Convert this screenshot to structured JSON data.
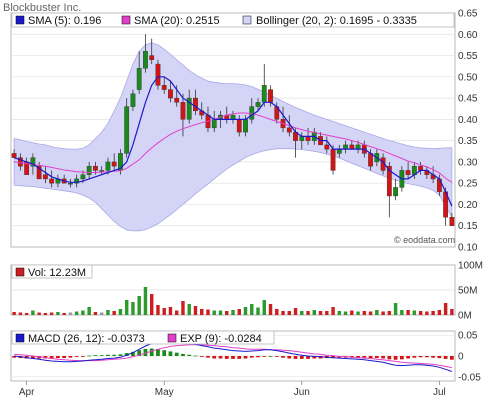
{
  "title": "Blockbuster Inc.",
  "watermark": "© eoddata.com",
  "colors": {
    "frame": "#b8b8b8",
    "grid": "#e2e2e2",
    "band_fill": "#d4d4f6",
    "band_edge": "#a8a8e8",
    "sma5": "#1a1acc",
    "sma20": "#e040c8",
    "up": "#1a8a1a",
    "down": "#d41414",
    "vol_up": "#2c9a2c",
    "vol_down": "#cc2020",
    "vol_neutral": "#999999",
    "macd": "#1a1acc",
    "exp": "#e040c8",
    "hist_pos": "#1a8a1a",
    "hist_neg": "#d41414"
  },
  "chart_data": [
    {
      "type": "candlestick",
      "title": "Blockbuster Inc.",
      "ylim": [
        0.1,
        0.65
      ],
      "ytick_labels": [
        "0.65",
        "0.60",
        "0.55",
        "0.50",
        "0.45",
        "0.40",
        "0.35",
        "0.30",
        "0.25",
        "0.20",
        "0.15",
        "0.10"
      ],
      "ytick_values": [
        0.65,
        0.6,
        0.55,
        0.5,
        0.45,
        0.4,
        0.35,
        0.3,
        0.25,
        0.2,
        0.15,
        0.1
      ],
      "x_tick_labels": [
        "Apr",
        "May",
        "Jun",
        "Jul"
      ],
      "legend": [
        {
          "key": "sma5",
          "label": "SMA (5): 0.196"
        },
        {
          "key": "sma20",
          "label": "SMA (20): 0.2515"
        },
        {
          "key": "bollinger",
          "label": "Bollinger (20, 2): 0.1695 - 0.3335"
        }
      ],
      "candles": [
        {
          "o": 0.32,
          "h": 0.33,
          "l": 0.31,
          "c": 0.31
        },
        {
          "o": 0.31,
          "h": 0.32,
          "l": 0.28,
          "c": 0.29
        },
        {
          "o": 0.3,
          "h": 0.31,
          "l": 0.27,
          "c": 0.27
        },
        {
          "o": 0.29,
          "h": 0.32,
          "l": 0.27,
          "c": 0.31
        },
        {
          "o": 0.29,
          "h": 0.3,
          "l": 0.26,
          "c": 0.26
        },
        {
          "o": 0.27,
          "h": 0.29,
          "l": 0.25,
          "c": 0.26
        },
        {
          "o": 0.26,
          "h": 0.28,
          "l": 0.24,
          "c": 0.25
        },
        {
          "o": 0.25,
          "h": 0.27,
          "l": 0.24,
          "c": 0.26
        },
        {
          "o": 0.26,
          "h": 0.27,
          "l": 0.25,
          "c": 0.25
        },
        {
          "o": 0.25,
          "h": 0.26,
          "l": 0.24,
          "c": 0.25
        },
        {
          "o": 0.25,
          "h": 0.27,
          "l": 0.24,
          "c": 0.26
        },
        {
          "o": 0.26,
          "h": 0.28,
          "l": 0.25,
          "c": 0.27
        },
        {
          "o": 0.27,
          "h": 0.3,
          "l": 0.26,
          "c": 0.29
        },
        {
          "o": 0.29,
          "h": 0.3,
          "l": 0.27,
          "c": 0.28
        },
        {
          "o": 0.28,
          "h": 0.29,
          "l": 0.27,
          "c": 0.28
        },
        {
          "o": 0.28,
          "h": 0.31,
          "l": 0.27,
          "c": 0.3
        },
        {
          "o": 0.3,
          "h": 0.32,
          "l": 0.28,
          "c": 0.29
        },
        {
          "o": 0.28,
          "h": 0.33,
          "l": 0.27,
          "c": 0.32
        },
        {
          "o": 0.32,
          "h": 0.45,
          "l": 0.31,
          "c": 0.43
        },
        {
          "o": 0.43,
          "h": 0.47,
          "l": 0.42,
          "c": 0.46
        },
        {
          "o": 0.47,
          "h": 0.56,
          "l": 0.46,
          "c": 0.52
        },
        {
          "o": 0.52,
          "h": 0.6,
          "l": 0.51,
          "c": 0.56
        },
        {
          "o": 0.55,
          "h": 0.59,
          "l": 0.53,
          "c": 0.54
        },
        {
          "o": 0.53,
          "h": 0.54,
          "l": 0.47,
          "c": 0.48
        },
        {
          "o": 0.48,
          "h": 0.5,
          "l": 0.46,
          "c": 0.47
        },
        {
          "o": 0.47,
          "h": 0.49,
          "l": 0.44,
          "c": 0.45
        },
        {
          "o": 0.45,
          "h": 0.48,
          "l": 0.43,
          "c": 0.44
        },
        {
          "o": 0.44,
          "h": 0.46,
          "l": 0.36,
          "c": 0.4
        },
        {
          "o": 0.4,
          "h": 0.47,
          "l": 0.39,
          "c": 0.45
        },
        {
          "o": 0.45,
          "h": 0.47,
          "l": 0.41,
          "c": 0.42
        },
        {
          "o": 0.42,
          "h": 0.44,
          "l": 0.4,
          "c": 0.41
        },
        {
          "o": 0.41,
          "h": 0.43,
          "l": 0.37,
          "c": 0.38
        },
        {
          "o": 0.38,
          "h": 0.42,
          "l": 0.37,
          "c": 0.4
        },
        {
          "o": 0.4,
          "h": 0.42,
          "l": 0.38,
          "c": 0.41
        },
        {
          "o": 0.41,
          "h": 0.43,
          "l": 0.39,
          "c": 0.4
        },
        {
          "o": 0.4,
          "h": 0.42,
          "l": 0.39,
          "c": 0.41
        },
        {
          "o": 0.4,
          "h": 0.41,
          "l": 0.36,
          "c": 0.37
        },
        {
          "o": 0.37,
          "h": 0.41,
          "l": 0.36,
          "c": 0.4
        },
        {
          "o": 0.4,
          "h": 0.45,
          "l": 0.39,
          "c": 0.43
        },
        {
          "o": 0.43,
          "h": 0.45,
          "l": 0.42,
          "c": 0.44
        },
        {
          "o": 0.44,
          "h": 0.53,
          "l": 0.43,
          "c": 0.48
        },
        {
          "o": 0.47,
          "h": 0.48,
          "l": 0.43,
          "c": 0.44
        },
        {
          "o": 0.43,
          "h": 0.44,
          "l": 0.39,
          "c": 0.4
        },
        {
          "o": 0.4,
          "h": 0.43,
          "l": 0.37,
          "c": 0.38
        },
        {
          "o": 0.38,
          "h": 0.41,
          "l": 0.36,
          "c": 0.37
        },
        {
          "o": 0.37,
          "h": 0.38,
          "l": 0.31,
          "c": 0.35
        },
        {
          "o": 0.35,
          "h": 0.37,
          "l": 0.33,
          "c": 0.36
        },
        {
          "o": 0.36,
          "h": 0.38,
          "l": 0.34,
          "c": 0.35
        },
        {
          "o": 0.35,
          "h": 0.38,
          "l": 0.34,
          "c": 0.37
        },
        {
          "o": 0.36,
          "h": 0.37,
          "l": 0.34,
          "c": 0.34
        },
        {
          "o": 0.34,
          "h": 0.36,
          "l": 0.32,
          "c": 0.33
        },
        {
          "o": 0.33,
          "h": 0.34,
          "l": 0.27,
          "c": 0.28
        },
        {
          "o": 0.32,
          "h": 0.34,
          "l": 0.31,
          "c": 0.33
        },
        {
          "o": 0.33,
          "h": 0.35,
          "l": 0.32,
          "c": 0.34
        },
        {
          "o": 0.34,
          "h": 0.35,
          "l": 0.33,
          "c": 0.33
        },
        {
          "o": 0.33,
          "h": 0.35,
          "l": 0.32,
          "c": 0.34
        },
        {
          "o": 0.34,
          "h": 0.35,
          "l": 0.31,
          "c": 0.32
        },
        {
          "o": 0.32,
          "h": 0.33,
          "l": 0.28,
          "c": 0.29
        },
        {
          "o": 0.3,
          "h": 0.33,
          "l": 0.29,
          "c": 0.32
        },
        {
          "o": 0.31,
          "h": 0.32,
          "l": 0.27,
          "c": 0.28
        },
        {
          "o": 0.29,
          "h": 0.3,
          "l": 0.17,
          "c": 0.22
        },
        {
          "o": 0.22,
          "h": 0.26,
          "l": 0.21,
          "c": 0.24
        },
        {
          "o": 0.24,
          "h": 0.29,
          "l": 0.23,
          "c": 0.28
        },
        {
          "o": 0.28,
          "h": 0.3,
          "l": 0.26,
          "c": 0.27
        },
        {
          "o": 0.27,
          "h": 0.3,
          "l": 0.26,
          "c": 0.29
        },
        {
          "o": 0.29,
          "h": 0.3,
          "l": 0.27,
          "c": 0.28
        },
        {
          "o": 0.28,
          "h": 0.29,
          "l": 0.26,
          "c": 0.27
        },
        {
          "o": 0.27,
          "h": 0.29,
          "l": 0.25,
          "c": 0.26
        },
        {
          "o": 0.26,
          "h": 0.27,
          "l": 0.22,
          "c": 0.23
        },
        {
          "o": 0.23,
          "h": 0.24,
          "l": 0.15,
          "c": 0.17
        },
        {
          "o": 0.17,
          "h": 0.18,
          "l": 0.15,
          "c": 0.15
        }
      ],
      "sma5": [
        0.31,
        0.305,
        0.3,
        0.295,
        0.285,
        0.275,
        0.265,
        0.26,
        0.255,
        0.252,
        0.252,
        0.255,
        0.26,
        0.265,
        0.27,
        0.275,
        0.28,
        0.285,
        0.3,
        0.34,
        0.39,
        0.44,
        0.48,
        0.5,
        0.5,
        0.49,
        0.47,
        0.45,
        0.44,
        0.43,
        0.42,
        0.41,
        0.4,
        0.4,
        0.4,
        0.4,
        0.4,
        0.4,
        0.41,
        0.42,
        0.44,
        0.44,
        0.43,
        0.41,
        0.39,
        0.37,
        0.36,
        0.36,
        0.36,
        0.35,
        0.35,
        0.33,
        0.33,
        0.33,
        0.33,
        0.33,
        0.33,
        0.32,
        0.31,
        0.3,
        0.28,
        0.27,
        0.26,
        0.26,
        0.27,
        0.28,
        0.28,
        0.27,
        0.26,
        0.23,
        0.196
      ],
      "sma20": [
        0.3,
        0.298,
        0.296,
        0.294,
        0.292,
        0.29,
        0.287,
        0.284,
        0.281,
        0.279,
        0.277,
        0.276,
        0.275,
        0.275,
        0.276,
        0.277,
        0.278,
        0.279,
        0.285,
        0.295,
        0.305,
        0.32,
        0.333,
        0.345,
        0.355,
        0.365,
        0.372,
        0.378,
        0.383,
        0.388,
        0.392,
        0.396,
        0.4,
        0.405,
        0.41,
        0.413,
        0.415,
        0.415,
        0.413,
        0.41,
        0.405,
        0.4,
        0.395,
        0.39,
        0.385,
        0.38,
        0.376,
        0.372,
        0.369,
        0.366,
        0.363,
        0.36,
        0.357,
        0.354,
        0.35,
        0.346,
        0.341,
        0.336,
        0.331,
        0.326,
        0.32,
        0.314,
        0.308,
        0.302,
        0.298,
        0.293,
        0.288,
        0.282,
        0.274,
        0.262,
        0.2515
      ],
      "bb_upper": [
        0.355,
        0.352,
        0.348,
        0.345,
        0.342,
        0.34,
        0.336,
        0.333,
        0.331,
        0.33,
        0.33,
        0.332,
        0.34,
        0.355,
        0.37,
        0.39,
        0.42,
        0.45,
        0.49,
        0.53,
        0.56,
        0.575,
        0.58,
        0.575,
        0.565,
        0.553,
        0.54,
        0.528,
        0.515,
        0.505,
        0.497,
        0.49,
        0.487,
        0.485,
        0.484,
        0.484,
        0.483,
        0.481,
        0.477,
        0.471,
        0.464,
        0.457,
        0.449,
        0.442,
        0.435,
        0.428,
        0.422,
        0.416,
        0.41,
        0.405,
        0.4,
        0.395,
        0.39,
        0.385,
        0.38,
        0.375,
        0.37,
        0.365,
        0.36,
        0.355,
        0.35,
        0.346,
        0.342,
        0.338,
        0.335,
        0.333,
        0.332,
        0.331,
        0.332,
        0.333,
        0.3335
      ],
      "bb_lower": [
        0.245,
        0.244,
        0.243,
        0.242,
        0.24,
        0.238,
        0.236,
        0.234,
        0.232,
        0.23,
        0.227,
        0.222,
        0.215,
        0.205,
        0.19,
        0.175,
        0.16,
        0.148,
        0.14,
        0.138,
        0.138,
        0.141,
        0.147,
        0.155,
        0.165,
        0.176,
        0.188,
        0.2,
        0.212,
        0.225,
        0.237,
        0.248,
        0.26,
        0.272,
        0.283,
        0.293,
        0.302,
        0.31,
        0.317,
        0.322,
        0.326,
        0.329,
        0.331,
        0.331,
        0.331,
        0.33,
        0.329,
        0.327,
        0.325,
        0.322,
        0.318,
        0.314,
        0.309,
        0.303,
        0.297,
        0.291,
        0.285,
        0.279,
        0.273,
        0.267,
        0.262,
        0.257,
        0.253,
        0.249,
        0.246,
        0.243,
        0.239,
        0.233,
        0.222,
        0.195,
        0.1695
      ]
    },
    {
      "type": "bar",
      "title": "Volume",
      "legend": [
        {
          "key": "vol",
          "label": "Vol: 12.23M"
        }
      ],
      "ylim": [
        0,
        100
      ],
      "ytick_labels": [
        "100M",
        "50M",
        "0M"
      ],
      "ytick_values": [
        100,
        50,
        0
      ],
      "unit": "M",
      "values": [
        6,
        5,
        4,
        9,
        5,
        4,
        5,
        6,
        4,
        5,
        7,
        9,
        16,
        6,
        5,
        10,
        8,
        12,
        30,
        26,
        38,
        56,
        42,
        20,
        14,
        16,
        9,
        28,
        22,
        18,
        12,
        11,
        9,
        9,
        8,
        10,
        12,
        16,
        22,
        15,
        30,
        22,
        12,
        8,
        8,
        14,
        8,
        8,
        10,
        8,
        8,
        16,
        8,
        7,
        9,
        7,
        8,
        7,
        10,
        7,
        8,
        24,
        10,
        10,
        9,
        8,
        7,
        8,
        10,
        24,
        12
      ]
    },
    {
      "type": "line",
      "title": "MACD",
      "legend": [
        {
          "key": "macd",
          "label": "MACD (26, 12): -0.0373"
        },
        {
          "key": "exp",
          "label": "EXP (9): -0.0284"
        }
      ],
      "ylim": [
        -0.06,
        0.06
      ],
      "ytick_labels": [
        "0.05",
        "0",
        "-0.05"
      ],
      "ytick_values": [
        0.05,
        0,
        -0.05
      ],
      "macd": [
        0.0,
        -0.002,
        -0.004,
        -0.006,
        -0.008,
        -0.01,
        -0.012,
        -0.013,
        -0.014,
        -0.014,
        -0.013,
        -0.012,
        -0.01,
        -0.009,
        -0.008,
        -0.006,
        -0.005,
        -0.003,
        0.002,
        0.008,
        0.016,
        0.024,
        0.03,
        0.033,
        0.034,
        0.034,
        0.033,
        0.031,
        0.03,
        0.028,
        0.025,
        0.022,
        0.019,
        0.017,
        0.015,
        0.013,
        0.012,
        0.011,
        0.012,
        0.013,
        0.015,
        0.015,
        0.013,
        0.01,
        0.007,
        0.004,
        0.002,
        0.0,
        -0.001,
        -0.002,
        -0.003,
        -0.004,
        -0.005,
        -0.006,
        -0.007,
        -0.008,
        -0.009,
        -0.011,
        -0.013,
        -0.015,
        -0.019,
        -0.022,
        -0.023,
        -0.022,
        -0.021,
        -0.021,
        -0.022,
        -0.024,
        -0.027,
        -0.032,
        -0.0373
      ],
      "exp": [
        0.004,
        0.003,
        0.002,
        0.0,
        -0.002,
        -0.004,
        -0.006,
        -0.008,
        -0.009,
        -0.01,
        -0.011,
        -0.011,
        -0.011,
        -0.011,
        -0.01,
        -0.009,
        -0.008,
        -0.007,
        -0.005,
        -0.002,
        0.002,
        0.007,
        0.012,
        0.016,
        0.02,
        0.023,
        0.025,
        0.026,
        0.027,
        0.027,
        0.027,
        0.026,
        0.025,
        0.023,
        0.022,
        0.02,
        0.019,
        0.017,
        0.016,
        0.016,
        0.016,
        0.015,
        0.015,
        0.014,
        0.013,
        0.011,
        0.009,
        0.007,
        0.005,
        0.004,
        0.002,
        0.001,
        -0.001,
        -0.002,
        -0.003,
        -0.004,
        -0.005,
        -0.006,
        -0.008,
        -0.009,
        -0.011,
        -0.013,
        -0.015,
        -0.016,
        -0.017,
        -0.018,
        -0.019,
        -0.02,
        -0.022,
        -0.025,
        -0.0284
      ]
    }
  ]
}
